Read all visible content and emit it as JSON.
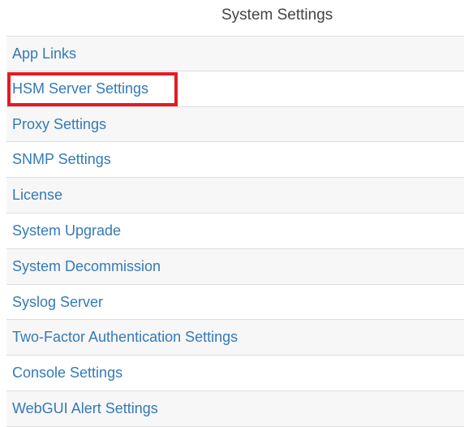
{
  "page": {
    "title": "System Settings"
  },
  "settings": {
    "items": [
      {
        "label": "App Links"
      },
      {
        "label": "HSM Server Settings"
      },
      {
        "label": "Proxy Settings"
      },
      {
        "label": "SNMP Settings"
      },
      {
        "label": "License"
      },
      {
        "label": "System Upgrade"
      },
      {
        "label": "System Decommission"
      },
      {
        "label": "Syslog Server"
      },
      {
        "label": "Two-Factor Authentication Settings"
      },
      {
        "label": "Console Settings"
      },
      {
        "label": "WebGUI Alert Settings"
      }
    ]
  },
  "highlight": {
    "color": "#e31b23",
    "target": "HSM Server Settings"
  },
  "colors": {
    "link": "#337ab7",
    "title": "#444444",
    "border": "#dddddd",
    "stripe": "#f7f7f7"
  }
}
